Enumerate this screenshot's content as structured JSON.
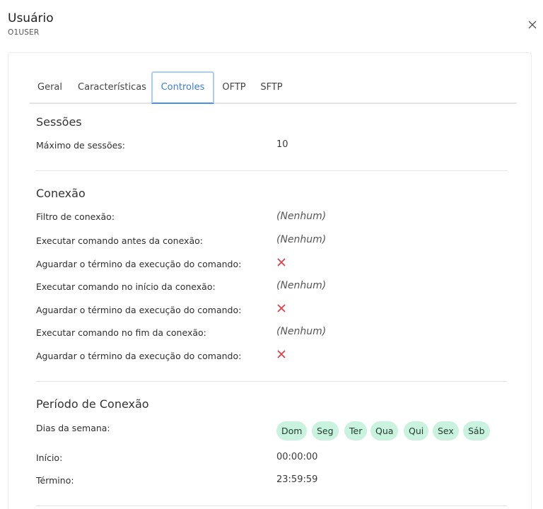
{
  "header": {
    "title": "Usuário",
    "subtitle": "O1USER"
  },
  "tabs": [
    {
      "label": "Geral"
    },
    {
      "label": "Características"
    },
    {
      "label": "Controles",
      "active": true
    },
    {
      "label": "OFTP"
    },
    {
      "label": "SFTP"
    }
  ],
  "sessions": {
    "title": "Sessões",
    "max_label": "Máximo de sessões:",
    "max_value": "10"
  },
  "connection": {
    "title": "Conexão",
    "rows": [
      {
        "label": "Filtro de conexão:",
        "value": "(Nenhum)"
      },
      {
        "label": "Executar comando antes da conexão:",
        "value": "(Nenhum)"
      },
      {
        "label": "Aguardar o término da execução do comando:",
        "value": "no"
      },
      {
        "label": "Executar comando no início da conexão:",
        "value": "(Nenhum)"
      },
      {
        "label": "Aguardar o término da execução do comando:",
        "value": "no"
      },
      {
        "label": "Executar comando no fim da conexão:",
        "value": "(Nenhum)"
      },
      {
        "label": "Aguardar o término da execução do comando:",
        "value": "no"
      }
    ]
  },
  "period": {
    "title": "Período de Conexão",
    "days_label": "Dias da semana:",
    "days": [
      "Dom",
      "Seg",
      "Ter",
      "Qua",
      "Qui",
      "Sex",
      "Sáb"
    ],
    "start_label": "Início:",
    "start_value": "00:00:00",
    "end_label": "Término:",
    "end_value": "23:59:59"
  },
  "colors": {
    "accent": "#3a7fd4",
    "chip_bg": "#c9f3de",
    "false_mark": "#e0404a"
  },
  "icons": {
    "close": "close-icon",
    "false": "x-mark-icon"
  }
}
